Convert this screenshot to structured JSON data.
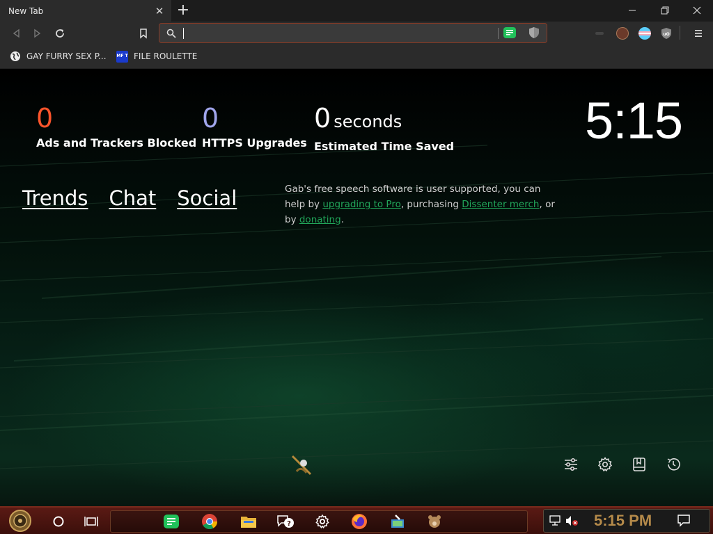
{
  "window": {
    "tab_title": "New Tab",
    "tab_close": "✕",
    "new_tab": "+"
  },
  "bookmarks": [
    {
      "label": "GAY FURRY SEX P...",
      "icon": "globe-icon"
    },
    {
      "label": "FILE ROULETTE",
      "icon": "mft-icon",
      "icon_text": "MF T"
    }
  ],
  "stats": {
    "ads_count": "0",
    "ads_label": "Ads and Trackers Blocked",
    "https_count": "0",
    "https_label": "HTTPS Upgrades",
    "time_value": "0",
    "time_unit": "seconds",
    "time_label": "Estimated Time Saved"
  },
  "clock": "5:15",
  "links": {
    "trends": "Trends",
    "chat": "Chat",
    "social": "Social"
  },
  "gab_message": {
    "part1": "Gab's free speech software is user supported, you can help by ",
    "link1": "upgrading to Pro",
    "part2": ", purchasing ",
    "link2": "Dissenter merch",
    "part3": ", or by ",
    "link3": "donating",
    "part4": "."
  },
  "taskbar": {
    "time": "5:15 PM"
  },
  "colors": {
    "ads_accent": "#fb542b",
    "https_accent": "#a0a5eb",
    "link_green": "#21a65a",
    "urlbar_border": "#8a3a24"
  }
}
